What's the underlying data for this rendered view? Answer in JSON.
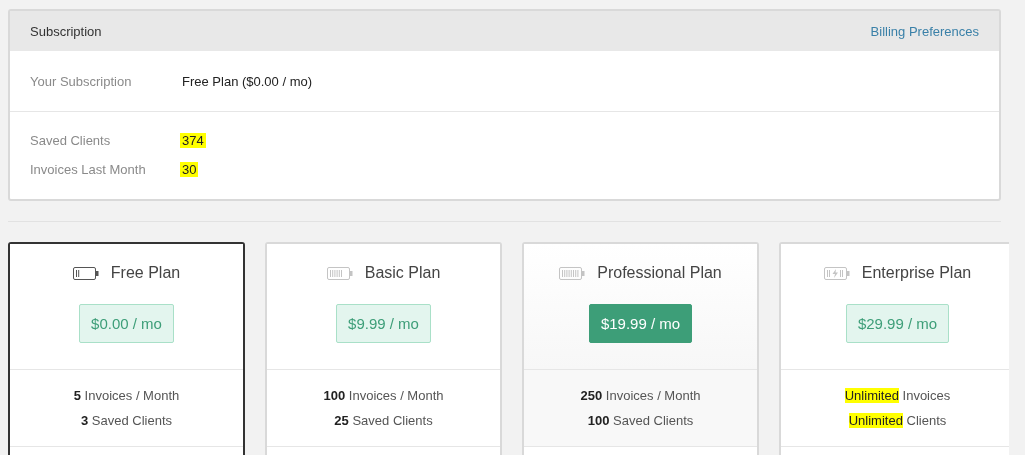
{
  "subscription": {
    "title": "Subscription",
    "link": "Billing Preferences",
    "current": {
      "label": "Your Subscription",
      "value": "Free Plan ($0.00 / mo)"
    },
    "stats": [
      {
        "label": "Saved Clients",
        "value": "374",
        "highlighted": true
      },
      {
        "label": "Invoices Last Month",
        "value": "30",
        "highlighted": true
      }
    ]
  },
  "plans": [
    {
      "name": "Free Plan",
      "price": "$0.00 / mo",
      "selected": true,
      "featured": false,
      "features": [
        {
          "lead": "5",
          "rest": "Invoices / Month",
          "highlighted": false
        },
        {
          "lead": "3",
          "rest": "Saved Clients",
          "highlighted": false
        }
      ]
    },
    {
      "name": "Basic Plan",
      "price": "$9.99 / mo",
      "selected": false,
      "featured": false,
      "features": [
        {
          "lead": "100",
          "rest": "Invoices / Month",
          "highlighted": false
        },
        {
          "lead": "25",
          "rest": "Saved Clients",
          "highlighted": false
        }
      ]
    },
    {
      "name": "Professional Plan",
      "price": "$19.99 / mo",
      "selected": false,
      "featured": true,
      "features": [
        {
          "lead": "250",
          "rest": "Invoices / Month",
          "highlighted": false
        },
        {
          "lead": "100",
          "rest": "Saved Clients",
          "highlighted": false
        }
      ]
    },
    {
      "name": "Enterprise Plan",
      "price": "$29.99 / mo",
      "selected": false,
      "featured": false,
      "features": [
        {
          "lead": "Unlimited",
          "rest": "Invoices",
          "highlighted": true
        },
        {
          "lead": "Unlimited",
          "rest": "Clients",
          "highlighted": true
        }
      ]
    }
  ]
}
